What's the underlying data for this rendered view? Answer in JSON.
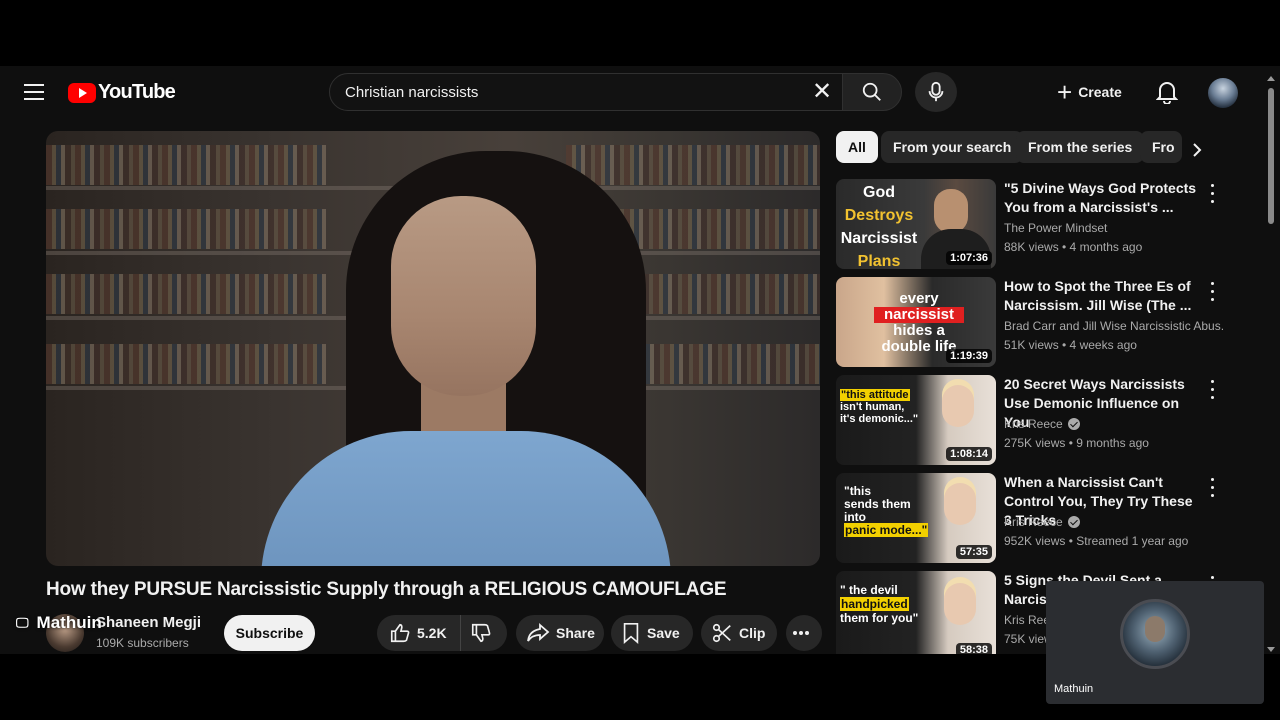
{
  "header": {
    "logo_text": "YouTube",
    "search_value": "Christian narcissists",
    "create_label": "Create"
  },
  "video": {
    "title": "How they PURSUE Narcissistic Supply through a RELIGIOUS CAMOUFLAGE",
    "channel_name": "Shaneen Megji",
    "subscribers": "109K subscribers",
    "subscribe_label": "Subscribe",
    "likes": "5.2K",
    "share_label": "Share",
    "save_label": "Save",
    "clip_label": "Clip",
    "overlay_user": "Mathuin"
  },
  "chips": [
    {
      "label": "All",
      "active": true
    },
    {
      "label": "From your search"
    },
    {
      "label": "From the series"
    },
    {
      "label": "Fro"
    }
  ],
  "recommendations": [
    {
      "title": "\"5 Divine Ways God Protects You from a Narcissist's ...",
      "channel": "The Power Mindset",
      "verified": false,
      "meta": "88K views • 4 months ago",
      "duration": "1:07:36",
      "thumb_lines": [
        "God",
        "Destroys",
        "Narcissist",
        "Plans"
      ]
    },
    {
      "title": "How to Spot the Three Es of Narcissism. Jill Wise (The ...",
      "channel": "Brad Carr and Jill Wise Narcissistic Abus...",
      "verified": false,
      "meta": "51K views • 4 weeks ago",
      "duration": "1:19:39",
      "thumb_lines": [
        "every",
        "narcissist",
        "hides a",
        "double life"
      ]
    },
    {
      "title": "20 Secret Ways Narcissists Use Demonic Influence on You",
      "channel": "Kris Reece",
      "verified": true,
      "meta": "275K views • 9 months ago",
      "duration": "1:08:14",
      "thumb_lines": [
        "\"this attitude",
        "isn't human,",
        "it's demonic...\""
      ]
    },
    {
      "title": "When a Narcissist Can't Control You, They Try These 3 Tricks",
      "channel": "Kris Reece",
      "verified": true,
      "meta": "952K views • Streamed 1 year ago",
      "duration": "57:35",
      "thumb_lines": [
        "\"this",
        "sends them",
        "into",
        "panic mode...\""
      ]
    },
    {
      "title": "5 Signs the Devil Sent a Narcissist",
      "channel": "Kris Reece",
      "verified": true,
      "meta": "75K views",
      "duration": "58:38",
      "thumb_lines": [
        "\" the devil",
        "handpicked",
        "them for you\""
      ]
    }
  ],
  "camera": {
    "name": "Mathuin"
  },
  "colors": {
    "background": "#0f0f0f",
    "brand_red": "#ff0000",
    "chip": "#272727",
    "text_secondary": "#aaaaaa"
  }
}
